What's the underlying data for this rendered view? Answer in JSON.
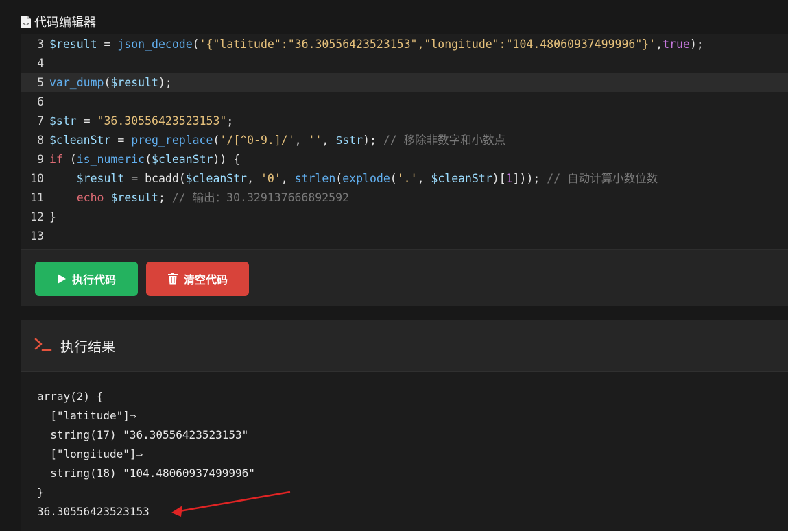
{
  "header": {
    "title": "代码编辑器",
    "icon": "code-file-icon"
  },
  "editor": {
    "lines": [
      {
        "num": "3",
        "active": false,
        "tokens": [
          {
            "t": "var",
            "v": "$result"
          },
          {
            "t": "punc",
            "v": " = "
          },
          {
            "t": "fn",
            "v": "json_decode"
          },
          {
            "t": "punc",
            "v": "("
          },
          {
            "t": "str",
            "v": "'{\"latitude\":\"36.30556423523153\",\"longitude\":\"104.48060937499996\"}'"
          },
          {
            "t": "punc",
            "v": ","
          },
          {
            "t": "kw",
            "v": "true"
          },
          {
            "t": "punc",
            "v": ");"
          }
        ]
      },
      {
        "num": "4",
        "active": false,
        "tokens": []
      },
      {
        "num": "5",
        "active": true,
        "tokens": [
          {
            "t": "fn",
            "v": "var_dump"
          },
          {
            "t": "punc",
            "v": "("
          },
          {
            "t": "var",
            "v": "$result"
          },
          {
            "t": "punc",
            "v": ");"
          }
        ]
      },
      {
        "num": "6",
        "active": false,
        "tokens": []
      },
      {
        "num": "7",
        "active": false,
        "tokens": [
          {
            "t": "var",
            "v": "$str"
          },
          {
            "t": "punc",
            "v": " = "
          },
          {
            "t": "str",
            "v": "\"36.30556423523153\""
          },
          {
            "t": "punc",
            "v": ";"
          }
        ]
      },
      {
        "num": "8",
        "active": false,
        "tokens": [
          {
            "t": "var",
            "v": "$cleanStr"
          },
          {
            "t": "punc",
            "v": " = "
          },
          {
            "t": "fn",
            "v": "preg_replace"
          },
          {
            "t": "punc",
            "v": "("
          },
          {
            "t": "str",
            "v": "'/[^0-9.]/'"
          },
          {
            "t": "punc",
            "v": ", "
          },
          {
            "t": "str",
            "v": "''"
          },
          {
            "t": "punc",
            "v": ", "
          },
          {
            "t": "var",
            "v": "$str"
          },
          {
            "t": "punc",
            "v": "); "
          },
          {
            "t": "cmt",
            "v": "// 移除非数字和小数点"
          }
        ]
      },
      {
        "num": "9",
        "active": false,
        "tokens": [
          {
            "t": "kw2",
            "v": "if"
          },
          {
            "t": "punc",
            "v": " ("
          },
          {
            "t": "fn",
            "v": "is_numeric"
          },
          {
            "t": "punc",
            "v": "("
          },
          {
            "t": "var",
            "v": "$cleanStr"
          },
          {
            "t": "punc",
            "v": ")) {"
          }
        ]
      },
      {
        "num": "10",
        "active": false,
        "tokens": [
          {
            "t": "punc",
            "v": "    "
          },
          {
            "t": "var",
            "v": "$result"
          },
          {
            "t": "punc",
            "v": " = bcadd("
          },
          {
            "t": "var",
            "v": "$cleanStr"
          },
          {
            "t": "punc",
            "v": ", "
          },
          {
            "t": "str",
            "v": "'0'"
          },
          {
            "t": "punc",
            "v": ", "
          },
          {
            "t": "fn",
            "v": "strlen"
          },
          {
            "t": "punc",
            "v": "("
          },
          {
            "t": "fn",
            "v": "explode"
          },
          {
            "t": "punc",
            "v": "("
          },
          {
            "t": "str",
            "v": "'.'"
          },
          {
            "t": "punc",
            "v": ", "
          },
          {
            "t": "var",
            "v": "$cleanStr"
          },
          {
            "t": "punc",
            "v": ")["
          },
          {
            "t": "num",
            "v": "1"
          },
          {
            "t": "punc",
            "v": "])); "
          },
          {
            "t": "cmt",
            "v": "// 自动计算小数位数"
          }
        ]
      },
      {
        "num": "11",
        "active": false,
        "tokens": [
          {
            "t": "punc",
            "v": "    "
          },
          {
            "t": "kw2",
            "v": "echo"
          },
          {
            "t": "punc",
            "v": " "
          },
          {
            "t": "var",
            "v": "$result"
          },
          {
            "t": "punc",
            "v": "; "
          },
          {
            "t": "cmt",
            "v": "// 输出：30.329137666892592"
          }
        ]
      },
      {
        "num": "12",
        "active": false,
        "tokens": [
          {
            "t": "punc",
            "v": "}"
          }
        ]
      },
      {
        "num": "13",
        "active": false,
        "tokens": []
      }
    ]
  },
  "toolbar": {
    "run_label": "执行代码",
    "clear_label": "清空代码",
    "run_color": "#24b25f",
    "clear_color": "#d8433a"
  },
  "result": {
    "title": "执行结果",
    "icon": "terminal-prompt-icon",
    "output_lines": [
      "array(2) {",
      "  [\"latitude\"]⇒",
      "  string(17) \"36.30556423523153\"",
      "  [\"longitude\"]⇒",
      "  string(18) \"104.48060937499996\"",
      "}",
      "36.30556423523153"
    ]
  },
  "annotation": {
    "type": "red-arrow",
    "color": "#e02424"
  }
}
